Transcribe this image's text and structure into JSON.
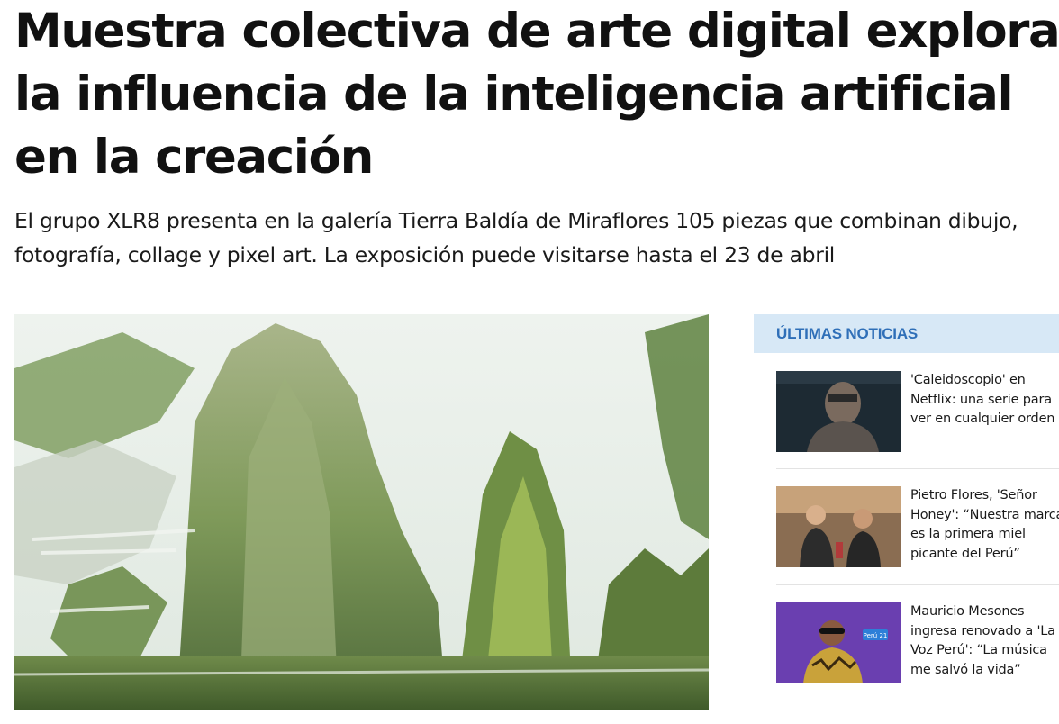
{
  "article": {
    "headline": "Muestra colectiva de arte digital explora la influencia de la inteligencia artificial en la creación",
    "subtitle": "El grupo XLR8 presenta en la galería Tierra Baldía de Miraflores 105 piezas que combinan dibujo, fotografía, collage y pixel art. La exposición puede visitarse hasta el 23 de abril"
  },
  "sidebar": {
    "title": "ÚLTIMAS NOTICIAS",
    "items": [
      {
        "text": "'Caleidoscopio' en\nNetflix: una serie para\nver en cualquier orden"
      },
      {
        "text": "Pietro Flores, 'Señor\nHoney': “Nuestra marca\nes la primera miel\npicante del Perú”"
      },
      {
        "text": "Mauricio Mesones\ningresa renovado a 'La\nVoz Perú': “La música\nme salvó la vida”",
        "thumb_badge": "Perú 21"
      }
    ]
  },
  "colors": {
    "accent": "#2f6fb8",
    "sidebar_header_bg": "#d7e8f6"
  }
}
